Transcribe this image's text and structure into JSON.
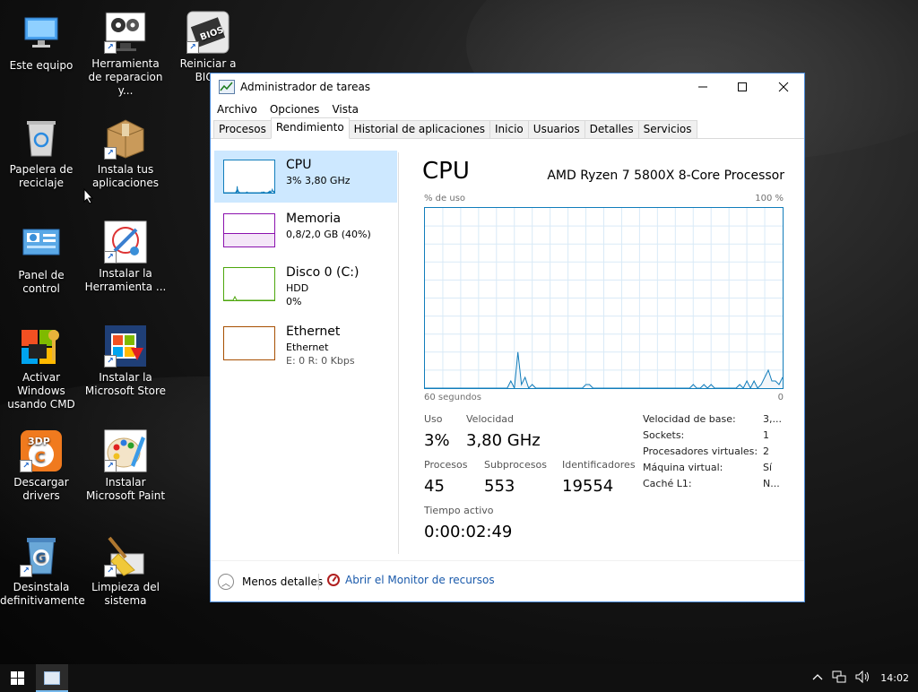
{
  "desktop": {
    "icons": [
      {
        "label": "Este equipo",
        "icon": "computer-icon"
      },
      {
        "label": "Herramienta de reparacion   y...",
        "icon": "repair-tool-icon"
      },
      {
        "label": "Reiniciar a BIOS",
        "icon": "bios-chip-icon",
        "chip_text": "BIOS"
      },
      {
        "label": "Papelera de reciclaje",
        "icon": "recycle-bin-icon"
      },
      {
        "label": "Instala tus aplicaciones",
        "icon": "package-box-icon"
      },
      {
        "label": "Panel de control",
        "icon": "control-panel-icon"
      },
      {
        "label": "Instalar la Herramienta ...",
        "icon": "install-tool-icon"
      },
      {
        "label": "Activar Windows usando CMD",
        "icon": "windows-key-icon"
      },
      {
        "label": "Instalar la Microsoft Store",
        "icon": "store-icon"
      },
      {
        "label": "Descargar drivers",
        "icon": "drivers-icon",
        "badge_text": "3DP"
      },
      {
        "label": "Instalar Microsoft Paint",
        "icon": "paint-icon"
      },
      {
        "label": "Desinstala definitivamente",
        "icon": "uninstall-icon"
      },
      {
        "label": "Limpieza del sistema",
        "icon": "broom-icon"
      }
    ]
  },
  "window": {
    "title": "Administrador de tareas",
    "controls": {
      "minimize": "—",
      "maximize": "☐",
      "close": "✕"
    },
    "menu": [
      "Archivo",
      "Opciones",
      "Vista"
    ],
    "tabs": [
      "Procesos",
      "Rendimiento",
      "Historial de aplicaciones",
      "Inicio",
      "Usuarios",
      "Detalles",
      "Servicios"
    ],
    "active_tab": "Rendimiento"
  },
  "sidebar": [
    {
      "name": "CPU",
      "line1": "3% 3,80 GHz",
      "line2": "",
      "color": "#117dbb",
      "selected": true
    },
    {
      "name": "Memoria",
      "line1": "0,8/2,0 GB (40%)",
      "line2": "",
      "color": "#8b12ae",
      "selected": false
    },
    {
      "name": "Disco 0 (C:)",
      "line1": "HDD",
      "line2": "0%",
      "color": "#4da60c",
      "selected": false
    },
    {
      "name": "Ethernet",
      "line1": "Ethernet",
      "line2": "E: 0  R: 0 Kbps",
      "color": "#a74f01",
      "selected": false
    }
  ],
  "cpu": {
    "title": "CPU",
    "processor": "AMD Ryzen 7 5800X 8-Core Processor",
    "usage_label": "% de uso",
    "max_label": "100 %",
    "time_label": "60 segundos",
    "min_label": "0",
    "usage_history": [
      0,
      0,
      0,
      0,
      0,
      0,
      0,
      0,
      0,
      0,
      0,
      0,
      0,
      0,
      0,
      0,
      0,
      0,
      0,
      0,
      0,
      0,
      0,
      0,
      2,
      0,
      10,
      1,
      3,
      0,
      1,
      0,
      0,
      0,
      0,
      0,
      0,
      0,
      0,
      0,
      0,
      0,
      0,
      0,
      0,
      1,
      1,
      0,
      0,
      0,
      0,
      0,
      0,
      0,
      0,
      0,
      0,
      0,
      0,
      0,
      0,
      0,
      0,
      0,
      0,
      0,
      0,
      0,
      0,
      0,
      0,
      0,
      0,
      0,
      0,
      1,
      0,
      0,
      1,
      0,
      1,
      0,
      0,
      0,
      0,
      0,
      0,
      0,
      1,
      0,
      2,
      0,
      2,
      0,
      1,
      3,
      5,
      2,
      2,
      1,
      3
    ],
    "stats": {
      "uso_label": "Uso",
      "uso": "3%",
      "velocidad_label": "Velocidad",
      "velocidad": "3,80 GHz",
      "procesos_label": "Procesos",
      "procesos": "45",
      "subprocesos_label": "Subprocesos",
      "subprocesos": "553",
      "identificadores_label": "Identificadores",
      "identificadores": "19554",
      "tiempo_label": "Tiempo activo",
      "tiempo": "0:00:02:49"
    },
    "details": [
      {
        "k": "Velocidad de base:",
        "v": "3,..."
      },
      {
        "k": "Sockets:",
        "v": "1"
      },
      {
        "k": "Procesadores virtuales:",
        "v": "2"
      },
      {
        "k": "Máquina virtual:",
        "v": "Sí"
      },
      {
        "k": "Caché L1:",
        "v": "N..."
      }
    ]
  },
  "footer": {
    "less": "Menos detalles",
    "monitor": "Abrir el Monitor de recursos"
  },
  "taskbar": {
    "clock": "14:02",
    "tray_icons": [
      "chevron-up-icon",
      "network-icon",
      "volume-icon"
    ]
  }
}
